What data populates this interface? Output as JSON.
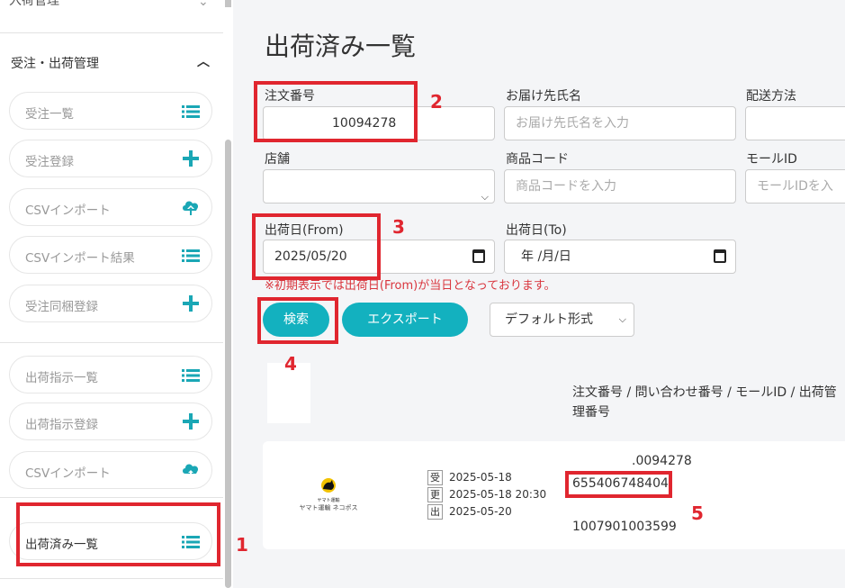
{
  "sidebar": {
    "top_partial_label": "入荷管理",
    "section_label": "受注・出荷管理",
    "items": [
      {
        "label": "受注一覧",
        "icon": "list-icon"
      },
      {
        "label": "受注登録",
        "icon": "plus-icon"
      },
      {
        "label": "CSVインポート",
        "icon": "cloud-upload-icon"
      },
      {
        "label": "CSVインポート結果",
        "icon": "list-icon"
      },
      {
        "label": "受注同梱登録",
        "icon": "plus-icon"
      },
      {
        "label": "出荷指示一覧",
        "icon": "list-icon"
      },
      {
        "label": "出荷指示登録",
        "icon": "plus-icon"
      },
      {
        "label": "CSVインポート",
        "icon": "cloud-upload-icon"
      },
      {
        "label": "出荷済み一覧",
        "icon": "list-icon"
      }
    ]
  },
  "page": {
    "title": "出荷済み一覧"
  },
  "form": {
    "order_number": {
      "label": "注文番号",
      "value": "10094278"
    },
    "recipient": {
      "label": "お届け先氏名",
      "placeholder": "お届け先氏名を入力"
    },
    "shipping_method": {
      "label": "配送方法"
    },
    "store": {
      "label": "店舗"
    },
    "product_code": {
      "label": "商品コード",
      "placeholder": "商品コードを入力"
    },
    "mall_id": {
      "label": "モールID",
      "placeholder": "モールIDを入"
    },
    "ship_date_from": {
      "label": "出荷日(From)",
      "value": "2025/05/20"
    },
    "ship_date_to": {
      "label": "出荷日(To)",
      "value": "年 /月/日"
    },
    "note": "※初期表示では出荷日(From)が当日となっております。"
  },
  "actions": {
    "search": "検索",
    "export": "エクスポート",
    "format_select": "デフォルト形式"
  },
  "table": {
    "column_header": "注文番号 / 問い合わせ番号 / モールID / 出荷管理番号",
    "rows": [
      {
        "carrier_logo_lines": [
          "ヤマト運輸",
          "ヤマト運輸 ネコポス"
        ],
        "dates": [
          {
            "tag": "受",
            "value": "2025-05-18"
          },
          {
            "tag": "更",
            "value": "2025-05-18 20:30"
          },
          {
            "tag": "出",
            "value": "2025-05-20"
          }
        ],
        "order_number": ".0094278",
        "tracking_number": "655406748404",
        "management_number": "1007901003599"
      }
    ]
  },
  "annotations": [
    "1",
    "2",
    "3",
    "4",
    "5"
  ],
  "colors": {
    "accent": "#13b1bf",
    "annotation": "#e0262f",
    "note": "#d9363e"
  }
}
